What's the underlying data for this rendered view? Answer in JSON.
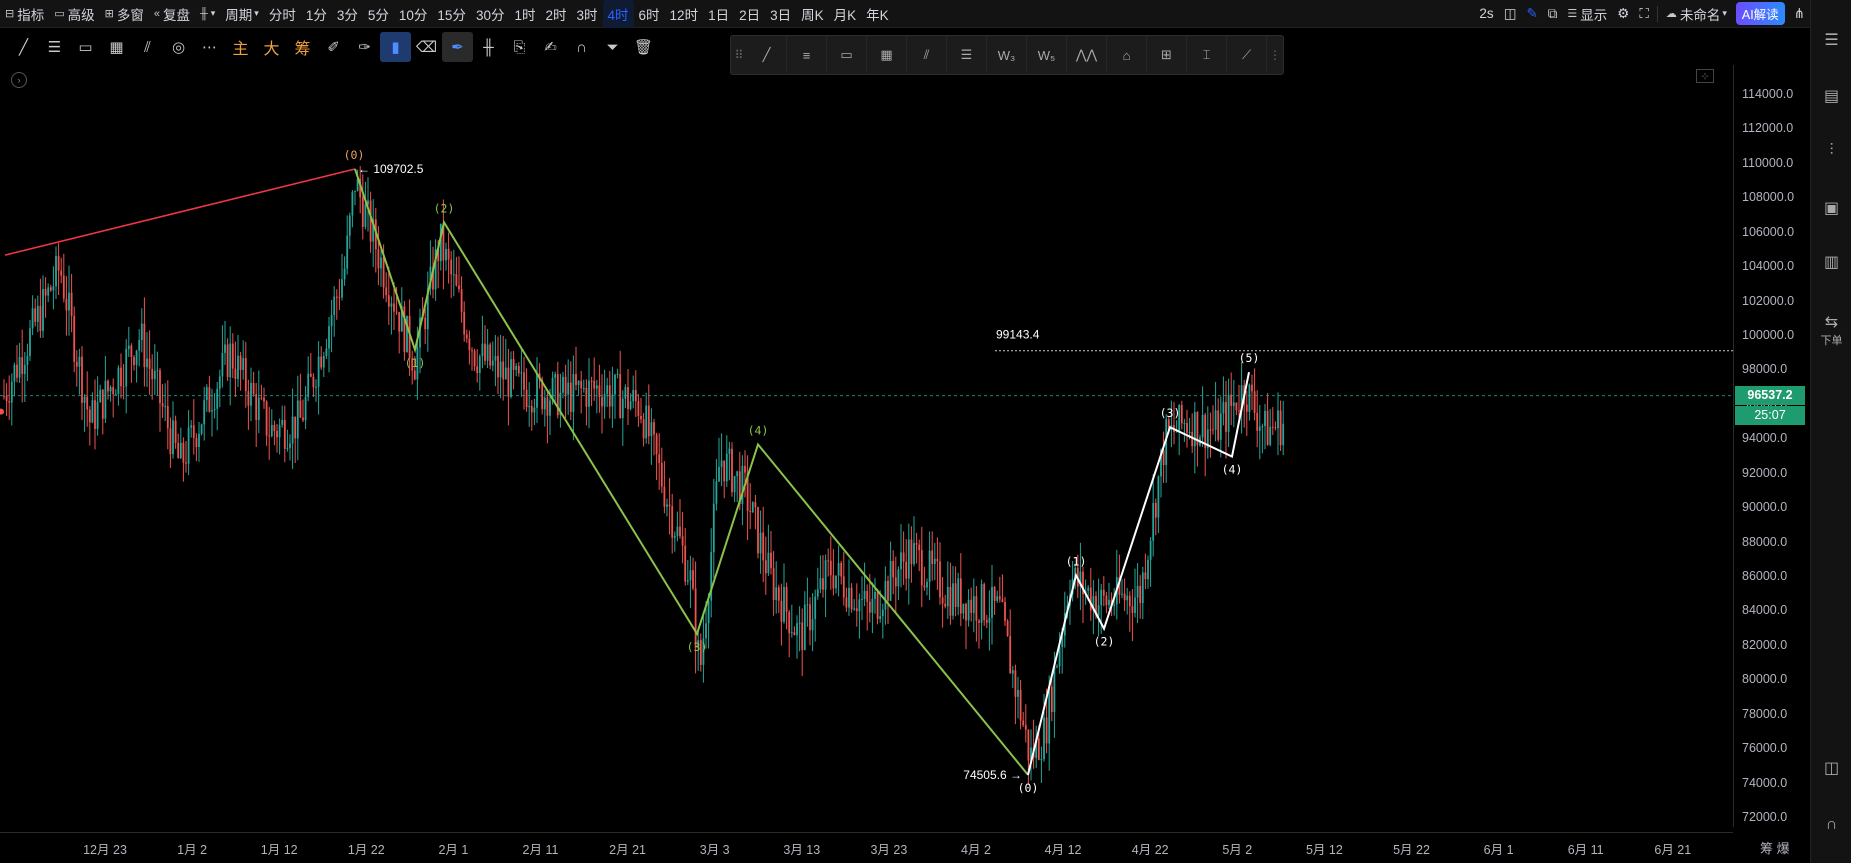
{
  "toolbar": {
    "indicators": "指标",
    "advanced": "高级",
    "multi_window": "多窗",
    "replay": "复盘",
    "period": "周期",
    "intervals": [
      "分时",
      "1分",
      "3分",
      "5分",
      "10分",
      "15分",
      "30分",
      "1时",
      "2时",
      "3时",
      "4时",
      "6时",
      "12时",
      "1日",
      "2日",
      "3日",
      "周K",
      "月K",
      "年K"
    ],
    "active_interval": "4时",
    "refresh": "2s",
    "display": "显示",
    "unnamed": "未命名",
    "ai": "AI解读"
  },
  "drawing_tools": {
    "main": "主",
    "big": "大",
    "chips": "筹"
  },
  "chart": {
    "labels": {
      "high_price": "109702.5",
      "low_price": "74505.6",
      "level_price": "99143.4"
    },
    "wave_labels_green": [
      "(0)",
      "(1)",
      "(2)",
      "(3)",
      "(4)"
    ],
    "wave_labels_white": [
      "(0)",
      "(1)",
      "(2)",
      "(3)",
      "(4)",
      "(5)"
    ],
    "colors": {
      "up": "#26a69a",
      "down": "#ef5350",
      "trend_line": "#f23645",
      "green_wave": "#8bc34a",
      "white_wave": "#ffffff",
      "current_price_badge": "#1e9c6f"
    }
  },
  "price_axis": {
    "ticks": [
      "114000.0",
      "112000.0",
      "110000.0",
      "108000.0",
      "106000.0",
      "104000.0",
      "102000.0",
      "100000.0",
      "98000.0",
      "96000.0",
      "94000.0",
      "92000.0",
      "90000.0",
      "88000.0",
      "86000.0",
      "84000.0",
      "82000.0",
      "80000.0",
      "78000.0",
      "76000.0",
      "74000.0",
      "72000.0"
    ],
    "current_price": "96537.2",
    "countdown": "25:07"
  },
  "time_axis": {
    "ticks": [
      "12月 23",
      "1月 2",
      "1月 12",
      "1月 22",
      "2月 1",
      "2月 11",
      "2月 21",
      "3月 3",
      "3月 13",
      "3月 23",
      "4月 2",
      "4月 12",
      "4月 22",
      "5月 2",
      "5月 12",
      "5月 22",
      "6月 1",
      "6月 11",
      "6月 21"
    ],
    "end_labels": "筹 爆"
  },
  "sidebar": {
    "order_label": "下单"
  }
}
